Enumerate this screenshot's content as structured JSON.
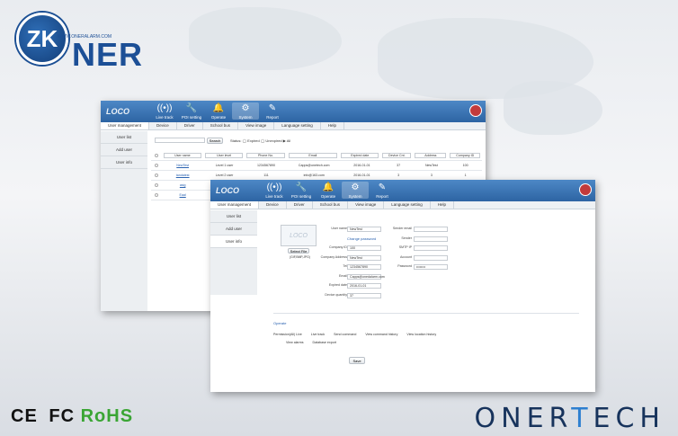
{
  "brand": {
    "logo_mark": "ZK",
    "logo_text": "NER",
    "logo_url": "WWW.ONERALARM.COM",
    "cert_ce": "CE",
    "cert_fc": "FC",
    "cert_rohs": "RoHS",
    "name_a": "ONER",
    "name_b": "T",
    "name_c": "ECH"
  },
  "app": {
    "logo": "LOCO",
    "nav": [
      {
        "icon": "signal-icon",
        "glyph": "((•))",
        "label": "Live track"
      },
      {
        "icon": "wrench-icon",
        "glyph": "🔧",
        "label": "POI setting"
      },
      {
        "icon": "bell-icon",
        "glyph": "🔔",
        "label": "Operate"
      },
      {
        "icon": "gear-icon",
        "glyph": "⚙",
        "label": "System"
      },
      {
        "icon": "report-icon",
        "glyph": "✎",
        "label": "Report"
      }
    ],
    "logout_label": "Logout",
    "tabs": [
      "User management",
      "Device",
      "Driver",
      "School bus",
      "View image",
      "Language setting",
      "Help"
    ],
    "side_items": [
      "User list",
      "Add user",
      "User info"
    ]
  },
  "back_window": {
    "search_label": "Search",
    "status_label": "Status: ◯ Expired ◯ Unexpired ▶ All",
    "columns": [
      "User name",
      "User level",
      "Phone No.",
      "Email",
      "Expired date",
      "Device Cnt.",
      "Address",
      "Company ID"
    ],
    "rows": [
      [
        "NewTest",
        "Level 1 user",
        "1234567890",
        "Capps@onetech.com",
        "2016-01-01",
        "37",
        "NewTest",
        "100"
      ],
      [
        "tandatest",
        "Level 2 user",
        "111",
        "info@163.com",
        "2016-01-01",
        "3",
        "3",
        "1"
      ],
      [
        "asig",
        "",
        "",
        "",
        "",
        "",
        "",
        ""
      ],
      [
        "Eaal",
        "",
        "",
        "",
        "",
        "",
        "",
        ""
      ]
    ]
  },
  "front_window": {
    "select_file_label": "Select File",
    "file_hint": "(GIF,BMP,JPG)",
    "left_fields": [
      {
        "label": "User name",
        "value": "NewTest"
      },
      {
        "label": "",
        "value": "Change password"
      },
      {
        "label": "Company ID",
        "value": "100"
      },
      {
        "label": "Company Address",
        "value": "NewTest"
      },
      {
        "label": "Tel",
        "value": "1234567890"
      },
      {
        "label": "Email",
        "value": "Capps@onedalarm.com"
      },
      {
        "label": "Expired date",
        "value": "2016-01-01"
      },
      {
        "label": "Device quantity",
        "value": "37"
      }
    ],
    "right_fields": [
      {
        "label": "Sender email",
        "value": ""
      },
      {
        "label": "Sender",
        "value": ""
      },
      {
        "label": "SMTP IP",
        "value": ""
      },
      {
        "label": "Account",
        "value": ""
      },
      {
        "label": "Password",
        "value": "••••••••"
      }
    ],
    "section_title": "Operate",
    "perms_row1": [
      "Permission(All) Live",
      "Live track",
      "Send command",
      "View command history",
      "View location history"
    ],
    "perms_row2": [
      "View alarms",
      "Database export"
    ],
    "save_label": "Save"
  }
}
